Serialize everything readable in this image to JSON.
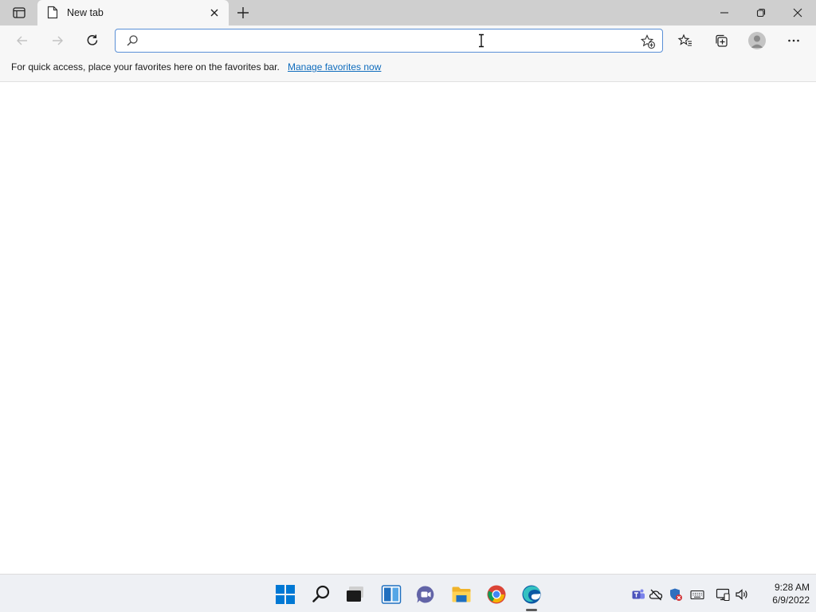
{
  "browser": {
    "tab": {
      "title": "New tab"
    },
    "address_bar": {
      "value": "",
      "placeholder": ""
    },
    "favorites_bar": {
      "message": "For quick access, place your favorites here on the favorites bar.",
      "link_label": "Manage favorites now"
    }
  },
  "icons": {
    "titlebar": [
      "tab-actions-icon",
      "page-icon",
      "close-tab-icon",
      "plus-icon",
      "minimize-icon",
      "restore-icon",
      "close-icon"
    ],
    "toolbar": [
      "back-arrow-icon",
      "forward-arrow-icon",
      "refresh-icon",
      "search-icon",
      "text-cursor-icon",
      "add-favorite-star-icon",
      "favorites-icon",
      "collections-icon",
      "profile-avatar-icon",
      "more-icon"
    ],
    "taskbar": [
      "windows-start-icon",
      "search-icon",
      "task-view-icon",
      "widgets-icon",
      "chat-icon",
      "file-explorer-icon",
      "chrome-icon",
      "edge-icon"
    ],
    "tray": [
      "teams-icon",
      "onedrive-icon",
      "security-icon",
      "keyboard-icon",
      "network-icon",
      "volume-icon"
    ]
  },
  "colors": {
    "link": "#0f6cbd",
    "address_border": "#5a8fd6",
    "start_blue": "#0078d4",
    "titlebar_bg": "#cfcfcf",
    "toolbar_bg": "#f7f7f7"
  },
  "taskbar": {
    "clock": {
      "time": "9:28 AM",
      "date": "6/9/2022"
    }
  }
}
